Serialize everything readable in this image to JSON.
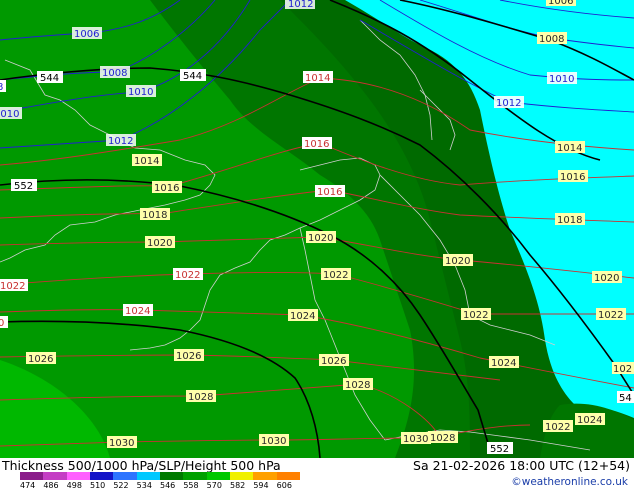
{
  "header": {
    "title": "Thickness 500/1000 hPa/SLP/Height 500 hPa",
    "valid_time": "Sa 21-02-2026 18:00 UTC (12+54)",
    "credit": "©weatheronline.co.uk"
  },
  "legend": {
    "ticks": [
      "474",
      "486",
      "498",
      "510",
      "522",
      "534",
      "546",
      "558",
      "570",
      "582",
      "594",
      "606"
    ],
    "colors": [
      "#8a1d8a",
      "#c43ec4",
      "#ff60ff",
      "#1414c8",
      "#2d74ff",
      "#00c8ff",
      "#007a00",
      "#00a000",
      "#00c800",
      "#f0f000",
      "#ffa000",
      "#ff8000"
    ]
  },
  "colors": {
    "dark_green": "#007600",
    "mid_green": "#009900",
    "light_green": "#00b800",
    "cyan": "#00ffff",
    "isobar_red": "#c83232",
    "isobar_blue": "#2020d0",
    "height_black": "#000000",
    "coast": "#cfcfcf"
  },
  "map": {
    "isobar_labels": [
      {
        "text": "1012",
        "color": "blue"
      },
      {
        "text": "1006",
        "color": "blue"
      },
      {
        "text": "1008",
        "color": "blue"
      },
      {
        "text": "1010",
        "color": "blue"
      },
      {
        "text": "1010",
        "color": "blue"
      },
      {
        "text": "1012",
        "color": "blue"
      },
      {
        "text": "1008",
        "color": "dark"
      },
      {
        "text": "1010",
        "color": "blue"
      },
      {
        "text": "1012",
        "color": "blue"
      },
      {
        "text": "1006",
        "color": "dark"
      },
      {
        "text": "1014",
        "color": "red"
      },
      {
        "text": "1014",
        "color": "dark"
      },
      {
        "text": "1016",
        "color": "red"
      },
      {
        "text": "1016",
        "color": "dark"
      },
      {
        "text": "1016",
        "color": "red"
      },
      {
        "text": "1018",
        "color": "dark"
      },
      {
        "text": "1020",
        "color": "dark"
      },
      {
        "text": "1020",
        "color": "dark"
      },
      {
        "text": "1020",
        "color": "dark"
      },
      {
        "text": "1022",
        "color": "red"
      },
      {
        "text": "1022",
        "color": "dark"
      },
      {
        "text": "1022",
        "color": "red"
      },
      {
        "text": "1022",
        "color": "dark"
      },
      {
        "text": "1024",
        "color": "red"
      },
      {
        "text": "1024",
        "color": "dark"
      },
      {
        "text": "1024",
        "color": "dark"
      },
      {
        "text": "1026",
        "color": "dark"
      },
      {
        "text": "1026",
        "color": "dark"
      },
      {
        "text": "1026",
        "color": "dark"
      },
      {
        "text": "1028",
        "color": "dark"
      },
      {
        "text": "1028",
        "color": "dark"
      },
      {
        "text": "1030",
        "color": "dark"
      },
      {
        "text": "1030",
        "color": "dark"
      },
      {
        "text": "1030",
        "color": "dark"
      },
      {
        "text": "1028",
        "color": "dark"
      },
      {
        "text": "1022",
        "color": "dark"
      },
      {
        "text": "1024",
        "color": "dark"
      },
      {
        "text": "1018",
        "color": "dark"
      },
      {
        "text": "1014",
        "color": "dark"
      },
      {
        "text": "1016",
        "color": "dark"
      },
      {
        "text": "1020",
        "color": "dark"
      },
      {
        "text": "1022",
        "color": "dark"
      },
      {
        "text": "1020",
        "color": "dark"
      },
      {
        "text": "1020",
        "color": "red"
      },
      {
        "text": "1022",
        "color": "dark"
      },
      {
        "text": "1012",
        "color": "blue"
      },
      {
        "text": "1010",
        "color": "blue"
      },
      {
        "text": "1010",
        "color": "blue"
      },
      {
        "text": "102",
        "color": "dark"
      },
      {
        "text": "1008",
        "color": "dark"
      },
      {
        "text": "1026",
        "color": "dark"
      },
      {
        "text": "1028",
        "color": "dark"
      },
      {
        "text": "1026",
        "color": "dark"
      },
      {
        "text": "0",
        "color": "red"
      },
      {
        "text": "8",
        "color": "blue"
      }
    ],
    "height_labels": [
      "544",
      "544",
      "552",
      "552",
      "54"
    ]
  }
}
